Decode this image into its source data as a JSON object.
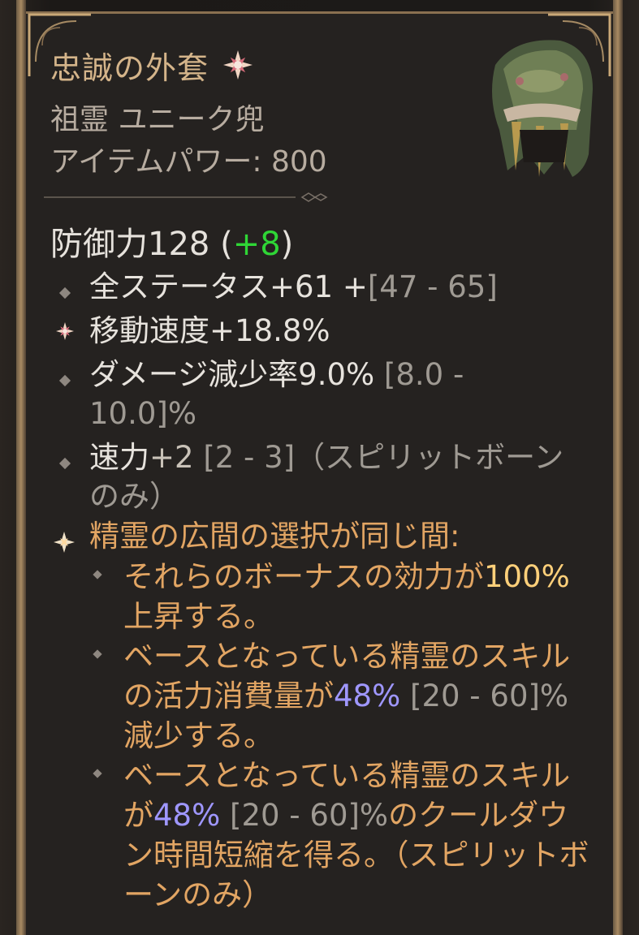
{
  "item": {
    "name": "忠誠の外套",
    "type": "祖霊 ユニーク兜",
    "power": "アイテムパワー: 800",
    "defense_label": "防御力128",
    "defense_bonus_open": " (",
    "defense_bonus": "+8",
    "defense_bonus_close": ")"
  },
  "affixes": [
    {
      "main": "全ステータス+61 +",
      "range": "[47 - 65]"
    },
    {
      "main": "移動速度+18.8%"
    },
    {
      "main": "ダメージ減少率9.0% ",
      "range": "[8.0 - 10.0]%"
    },
    {
      "main_a": "速力",
      "main_b": "+2 ",
      "range": "[2 - 3]",
      "tail": "（スピリットボーンのみ）"
    }
  ],
  "aspect": {
    "header": "精霊の広間の選択が同じ間:",
    "lines": [
      {
        "a": "それらのボーナスの効力が",
        "b": "100%",
        "c": "上昇する。"
      },
      {
        "a": "ベースとなっている精霊のスキルの活力消費量が",
        "b": "48%",
        "c": " [20 - 60]%",
        "d": "減少する。"
      },
      {
        "a": "ベースとなっている精霊のスキルが",
        "b": "48%",
        "c": " [20 - 60]%",
        "d": "のクールダウン時間短縮を得る。（スピリットボーンのみ）"
      }
    ]
  },
  "colors": {
    "title": "#d4b48a",
    "bonus_green": "#2fd636",
    "aspect_orange": "#e2a563",
    "highlight_blue": "#9f97ff"
  },
  "icons": {
    "unique": "unique-star-icon",
    "affix": "diamond-bullet-icon",
    "greater_affix": "sunburst-icon",
    "aspect": "four-point-star-icon"
  }
}
